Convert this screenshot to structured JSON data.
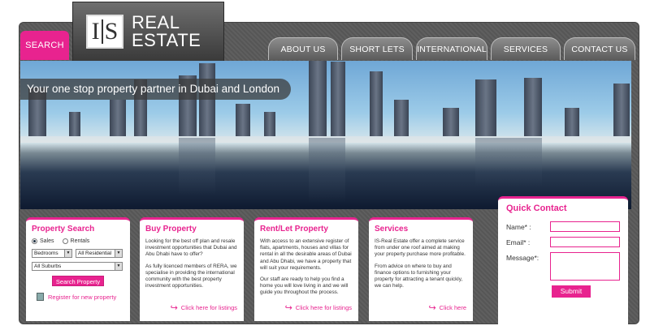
{
  "search_tab": "SEARCH",
  "logo": {
    "mark_left": "I",
    "mark_right": "S",
    "line1": "REAL",
    "line2": "ESTATE"
  },
  "nav": [
    "ABOUT US",
    "SHORT LETS",
    "INTERNATIONAL",
    "SERVICES",
    "CONTACT US"
  ],
  "banner": {
    "tagline": "Your one stop property partner in Dubai and London"
  },
  "property_search": {
    "title": "Property Search",
    "radio_sales": "Sales",
    "radio_rentals": "Rentals",
    "bedrooms": "Bedrooms",
    "type": "All Residential",
    "suburbs": "All Suburbs",
    "button": "Search Property",
    "register": "Register for new property"
  },
  "buy": {
    "title": "Buy Property",
    "p1": "Looking for the best off plan and resale investment opportunities that Dubai and Abu Dhabi have to offer?",
    "p2": "As fully licenced members of RERA, we specialise in providing the international community with the best property investment opportunities.",
    "link": "Click here for listings"
  },
  "rent": {
    "title": "Rent/Let Property",
    "p1": "With access to an extensive register of flats, apartments, houses and villas for rental in all the desirable areas of Dubai and Abu Dhabi, we have a property that will suit your requirements.",
    "p2": "Our staff are ready to help you find a home you will love living in and we will guide you throughout the process.",
    "link": "Click here for listings"
  },
  "services": {
    "title": "Services",
    "p1": "IS-Real Estate offer a complete service from under one roof aimed at making your property purchase more profitable.",
    "p2": "From advice on where to buy and finance options to furnishing your property for attracting a tenant quickly, we can help.",
    "link": "Click here"
  },
  "quick_contact": {
    "title": "Quick Contact",
    "name_label": "Name* :",
    "email_label": "Email* :",
    "message_label": "Message*:",
    "submit": "Submit"
  },
  "colors": {
    "accent": "#e8238f",
    "frame": "#5a5a5a"
  }
}
